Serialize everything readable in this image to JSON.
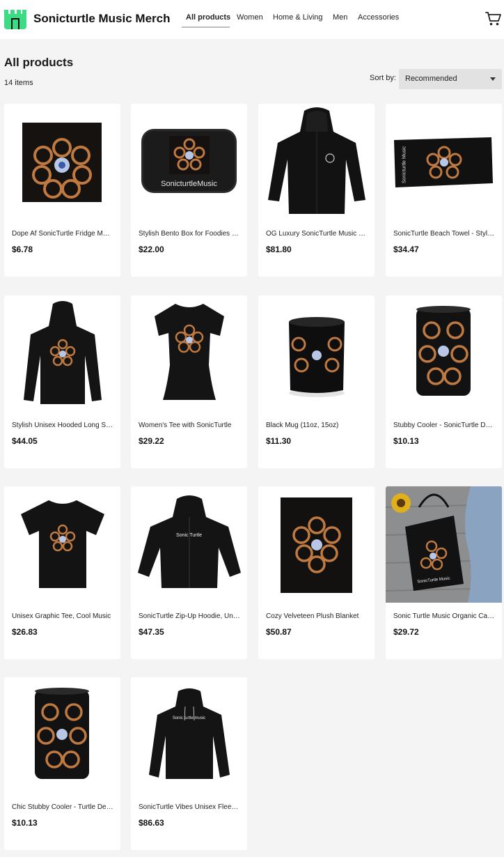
{
  "header": {
    "brand": "Sonicturtle Music Merch",
    "nav": [
      "All products",
      "Women",
      "Home & Living",
      "Men",
      "Accessories"
    ],
    "active_nav": "All products",
    "logo_icon": "castle-store-icon",
    "cart_icon": "shopping-cart-icon",
    "accent_color": "#3ddc84"
  },
  "listing": {
    "title": "All products",
    "count": "14 items",
    "sort_label": "Sort by:",
    "sort_value": "Recommended"
  },
  "products": [
    {
      "name": "Dope Af SonicTurtle Fridge Magnet",
      "price": "$6.78",
      "image": "square-magnet"
    },
    {
      "name": "Stylish Bento Box for Foodies - SonicturtleMusic",
      "price": "$22.00",
      "image": "bento-box"
    },
    {
      "name": "OG Luxury SonicTurtle Music Hoodie",
      "price": "$81.80",
      "image": "black-hoodie-small-logo"
    },
    {
      "name": "SonicTurtle Beach Towel - Stylish",
      "price": "$34.47",
      "image": "beach-towel"
    },
    {
      "name": "Stylish Unisex Hooded Long Sleeve",
      "price": "$44.05",
      "image": "hooded-long-sleeve"
    },
    {
      "name": "Women's Tee with SonicTurtle",
      "price": "$29.22",
      "image": "womens-tee"
    },
    {
      "name": "Black Mug (11oz, 15oz)",
      "price": "$11.30",
      "image": "black-mug"
    },
    {
      "name": "Stubby Cooler - SonicTurtle Design",
      "price": "$10.13",
      "image": "stubby-cooler"
    },
    {
      "name": "Unisex Graphic Tee, Cool Music",
      "price": "$26.83",
      "image": "unisex-tee"
    },
    {
      "name": "SonicTurtle Zip-Up Hoodie, Unisex",
      "price": "$47.35",
      "image": "zip-hoodie"
    },
    {
      "name": "Cozy Velveteen Plush Blanket",
      "price": "$50.87",
      "image": "plush-blanket"
    },
    {
      "name": "Sonic Turtle Music Organic Canvas Tote",
      "price": "$29.72",
      "image": "tote-bag"
    },
    {
      "name": "Chic Stubby Cooler - Turtle Design",
      "price": "$10.13",
      "image": "stubby-cooler"
    },
    {
      "name": "SonicTurtle Vibes Unisex Fleece Hoodie",
      "price": "$86.63",
      "image": "fleece-hoodie"
    }
  ],
  "product_text": {
    "bento_print": "SonicturtleMusic",
    "towel_print": "Sonicturtle Music",
    "zip_print": "Sonic Turtle",
    "tote_print": "SonicTurtle Music",
    "fleece_print": "Sonic turtle music"
  }
}
